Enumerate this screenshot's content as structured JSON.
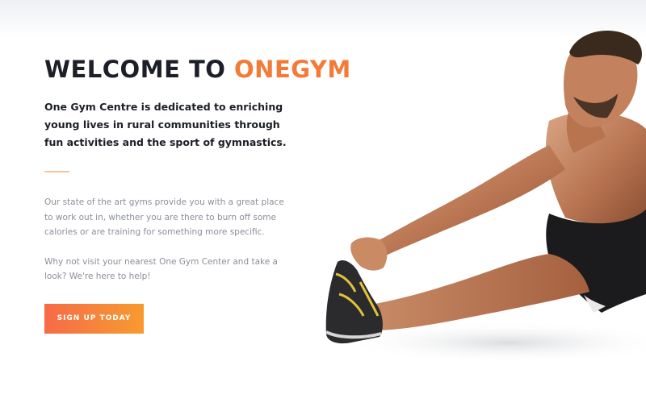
{
  "hero": {
    "title_prefix": "WELCOME TO ",
    "title_accent": "ONEGYM",
    "lead": "One Gym Centre is dedicated to enriching young lives in rural communities through fun activities and the sport of gymnastics.",
    "paragraph_1": "Our state of the art gyms provide you with a great place to work out in, whether you are there to burn off some calories or are training for something more specific.",
    "paragraph_2": "Why not visit your nearest One Gym Center and take a look? We're here to help!",
    "cta_label": "SIGN UP TODAY"
  },
  "colors": {
    "accent": "#f47a37",
    "heading": "#1c1f27",
    "body": "#8a8f99",
    "button_gradient_start": "#f66a48",
    "button_gradient_end": "#f89a2f"
  }
}
